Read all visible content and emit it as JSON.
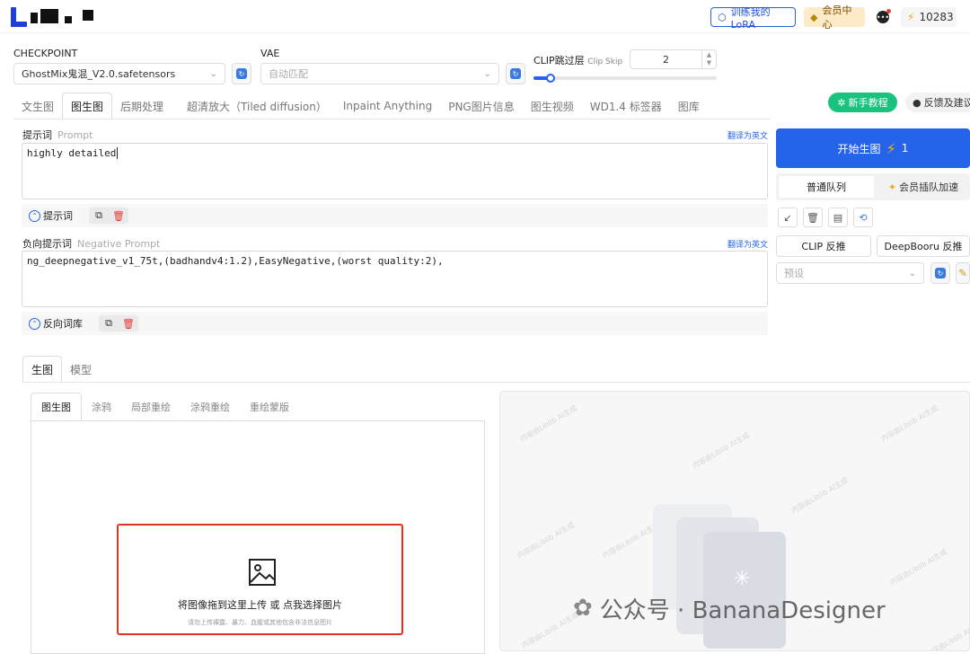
{
  "topbar": {
    "train_lora": "训练我的LoRA",
    "vip_center": "会员中心",
    "credits": "10283"
  },
  "models": {
    "checkpoint_label": "CHECKPOINT",
    "checkpoint_value": "GhostMix鬼混_V2.0.safetensors",
    "vae_label": "VAE",
    "vae_placeholder": "自动匹配",
    "clip_label": "CLIP跳过层",
    "clip_label_en": "Clip Skip",
    "clip_value": "2"
  },
  "main_tabs": [
    {
      "label": "文生图",
      "active": false
    },
    {
      "label": "图生图",
      "active": true
    },
    {
      "label": "后期处理",
      "active": false
    },
    {
      "label": "超清放大（Tiled diffusion）",
      "active": false
    },
    {
      "label": "Inpaint Anything",
      "active": false
    },
    {
      "label": "PNG图片信息",
      "active": false
    },
    {
      "label": "图生视频",
      "active": false
    },
    {
      "label": "WD1.4 标签器",
      "active": false
    },
    {
      "label": "图库",
      "active": false
    }
  ],
  "header_buttons": {
    "tutorial": "新手教程",
    "feedback": "反馈及建议"
  },
  "prompt": {
    "label": "提示词",
    "label_en": "Prompt",
    "translate": "翻译为英文",
    "value": "highly detailed",
    "toggle": "提示词"
  },
  "negative_prompt": {
    "label": "负向提示词",
    "label_en": "Negative Prompt",
    "translate": "翻译为英文",
    "value": "ng_deepnegative_v1_75t,(badhandv4:1.2),EasyNegative,(worst quality:2),",
    "toggle": "反向词库"
  },
  "right_panel": {
    "generate": "开始生图",
    "generate_count": "1",
    "queue_normal": "普通队列",
    "queue_vip": "会员插队加速",
    "clip_interrogate": "CLIP 反推",
    "deepbooru_interrogate": "DeepBooru 反推",
    "preset_placeholder": "预设"
  },
  "sub_tabs": [
    {
      "label": "生图",
      "active": true
    },
    {
      "label": "模型",
      "active": false
    }
  ],
  "img_tabs": [
    {
      "label": "图生图",
      "active": true
    },
    {
      "label": "涂鸦",
      "active": false
    },
    {
      "label": "局部重绘",
      "active": false
    },
    {
      "label": "涂鸦重绘",
      "active": false
    },
    {
      "label": "重绘蒙版",
      "active": false
    }
  ],
  "upload": {
    "title": "将图像拖到这里上传 或 点我选择图片",
    "hint": "请勿上传裸露、暴力、血腥或其他包含非法信息图片"
  },
  "output": {
    "watermark": "内容由Liblib AI生成"
  },
  "footer_watermark": "公众号 · BananaDesigner",
  "colors": {
    "primary": "#2563eb",
    "success": "#19c37d",
    "danger": "#e0341e"
  }
}
